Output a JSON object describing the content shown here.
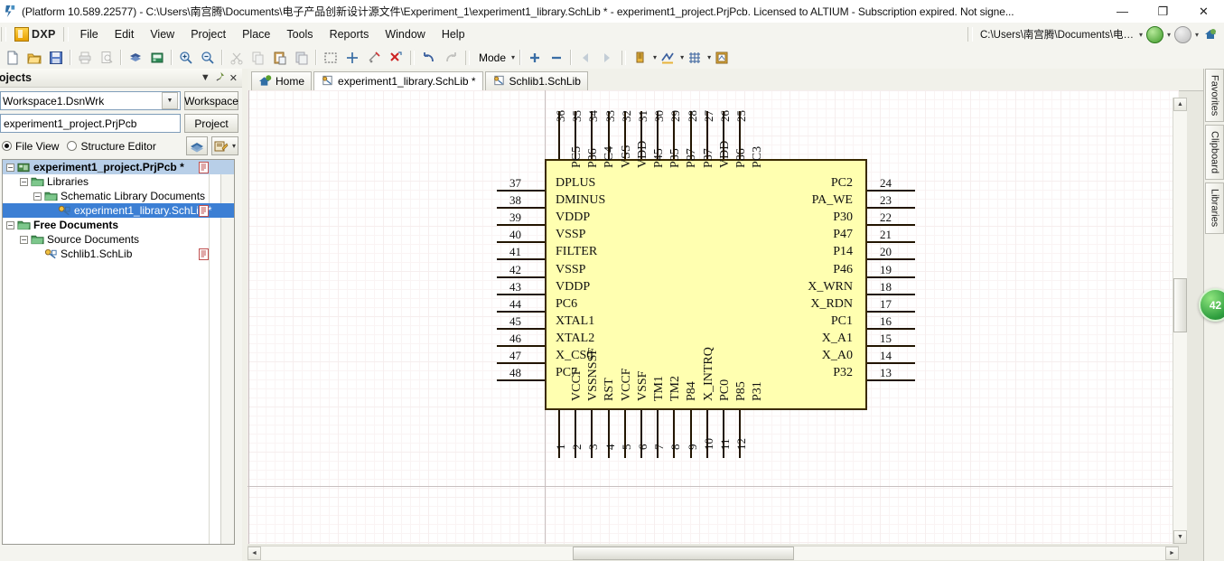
{
  "titlebar": {
    "text": "(Platform 10.589.22577) - C:\\Users\\南宫腾\\Documents\\电子产品创新设计源文件\\Experiment_1\\experiment1_library.SchLib * - experiment1_project.PrjPcb. Licensed to ALTIUM - Subscription expired. Not signe...",
    "minimize": "—",
    "maximize": "❐",
    "close": "✕",
    "app_icon": "altium-icon"
  },
  "menubar": {
    "dxp_label": "DXP",
    "items": [
      {
        "label": "File"
      },
      {
        "label": "Edit"
      },
      {
        "label": "View"
      },
      {
        "label": "Project"
      },
      {
        "label": "Place"
      },
      {
        "label": "Tools"
      },
      {
        "label": "Reports"
      },
      {
        "label": "Window"
      },
      {
        "label": "Help"
      }
    ],
    "address": "C:\\Users\\南宫腾\\Documents\\电…",
    "nav_back_icon": "back-arrow-icon",
    "nav_forward_icon": "forward-arrow-icon",
    "home_icon": "home-icon"
  },
  "toolbar": {
    "buttons": [
      {
        "name": "new-document",
        "icon": "new-doc-icon"
      },
      {
        "name": "open-document",
        "icon": "open-folder-icon"
      },
      {
        "name": "save-document",
        "icon": "save-disk-icon"
      },
      {
        "name": "print",
        "icon": "printer-icon"
      },
      {
        "name": "print-preview",
        "icon": "print-preview-icon"
      },
      {
        "name": "open-project",
        "icon": "project-icon"
      },
      {
        "name": "open-library",
        "icon": "library-icon"
      },
      {
        "name": "zoom-in",
        "icon": "zoom-in-icon"
      },
      {
        "name": "zoom-out",
        "icon": "zoom-out-icon"
      },
      {
        "name": "cut",
        "icon": "scissors-icon"
      },
      {
        "name": "copy",
        "icon": "copy-icon"
      },
      {
        "name": "paste",
        "icon": "paste-icon"
      },
      {
        "name": "paste-special",
        "icon": "paste-special-icon"
      },
      {
        "name": "select-area",
        "icon": "marquee-select-icon"
      },
      {
        "name": "move-selection",
        "icon": "move-cross-icon"
      },
      {
        "name": "clear-selection",
        "icon": "clear-select-icon"
      },
      {
        "name": "deselect-all",
        "icon": "deselect-x-icon"
      },
      {
        "name": "undo",
        "icon": "undo-arrow-icon"
      },
      {
        "name": "redo",
        "icon": "redo-arrow-icon"
      }
    ],
    "mode_label": "Mode",
    "mode_caret": "▾",
    "add_part_icon": "plus-icon",
    "remove_part_icon": "minus-icon",
    "prev_part_icon": "prev-arrow-icon",
    "next_part_icon": "next-arrow-icon",
    "pin_icon": "pin-tool-icon",
    "draw_icon": "draw-tool-icon",
    "grid_icon": "grid-icon",
    "sheet_icon": "sheet-icon"
  },
  "projects_panel": {
    "title": "rojects",
    "header_icons": [
      "chevron-down-icon",
      "pin-icon",
      "close-icon"
    ],
    "workspace_value": "Workspace1.DsnWrk",
    "workspace_button": "Workspace",
    "project_value": "experiment1_project.PrjPcb",
    "project_button": "Project",
    "file_view_label": "File View",
    "structure_editor_label": "Structure Editor",
    "view_mode": "File View",
    "layers_icon": "layers-icon",
    "options_icon": "panel-options-icon",
    "options_caret": "▾",
    "tree": [
      {
        "label": "experiment1_project.PrjPcb *",
        "indent": 0,
        "expander": "−",
        "icon": "project-node-icon",
        "bold": true,
        "selected": "light",
        "doc_badge": true
      },
      {
        "label": "Libraries",
        "indent": 1,
        "expander": "−",
        "icon": "folder-icon",
        "bold": false,
        "selected": "none",
        "doc_badge": false
      },
      {
        "label": "Schematic Library Documents",
        "indent": 2,
        "expander": "−",
        "icon": "folder-icon",
        "bold": false,
        "selected": "none",
        "doc_badge": false
      },
      {
        "label": "experiment1_library.SchLib *",
        "indent": 3,
        "expander": "",
        "icon": "schlib-icon",
        "bold": false,
        "selected": "full",
        "doc_badge": true
      },
      {
        "label": "Free Documents",
        "indent": 0,
        "expander": "−",
        "icon": "folder-icon",
        "bold": true,
        "selected": "none",
        "doc_badge": false
      },
      {
        "label": "Source Documents",
        "indent": 1,
        "expander": "−",
        "icon": "folder-icon",
        "bold": false,
        "selected": "none",
        "doc_badge": false
      },
      {
        "label": "Schlib1.SchLib",
        "indent": 2,
        "expander": "",
        "icon": "schlib-icon",
        "bold": false,
        "selected": "none",
        "doc_badge": true
      }
    ]
  },
  "document_tabs": [
    {
      "label": "Home",
      "icon": "home-tab-icon",
      "active": false
    },
    {
      "label": "experiment1_library.SchLib *",
      "icon": "schlib-tab-icon",
      "active": true
    },
    {
      "label": "Schlib1.SchLib",
      "icon": "schlib-tab-icon",
      "active": false
    }
  ],
  "right_dock": {
    "tabs": [
      "Favorites",
      "Clipboard",
      "Libraries"
    ],
    "badge": "42"
  },
  "scrollbars": {
    "v_up": "▲",
    "v_down": "▼",
    "h_left": "◄",
    "h_right": "►"
  },
  "schematic": {
    "body_color": "#ffffb0",
    "outline_color": "#3a2a00",
    "left_pins": [
      {
        "num": "37",
        "label": "DPLUS"
      },
      {
        "num": "38",
        "label": "DMINUS"
      },
      {
        "num": "39",
        "label": "VDDP"
      },
      {
        "num": "40",
        "label": "VSSP"
      },
      {
        "num": "41",
        "label": "FILTER"
      },
      {
        "num": "42",
        "label": "VSSP"
      },
      {
        "num": "43",
        "label": "VDDP"
      },
      {
        "num": "44",
        "label": "PC6"
      },
      {
        "num": "45",
        "label": "XTAL1"
      },
      {
        "num": "46",
        "label": "XTAL2"
      },
      {
        "num": "47",
        "label": "X_CS0"
      },
      {
        "num": "48",
        "label": "PC7"
      }
    ],
    "right_pins": [
      {
        "num": "24",
        "label": "PC2"
      },
      {
        "num": "23",
        "label": "PA_WE"
      },
      {
        "num": "22",
        "label": "P30"
      },
      {
        "num": "21",
        "label": "P47"
      },
      {
        "num": "20",
        "label": "P14"
      },
      {
        "num": "19",
        "label": "P46"
      },
      {
        "num": "18",
        "label": "X_WRN"
      },
      {
        "num": "17",
        "label": "X_RDN"
      },
      {
        "num": "16",
        "label": "PC1"
      },
      {
        "num": "15",
        "label": "X_A1"
      },
      {
        "num": "14",
        "label": "X_A0"
      },
      {
        "num": "13",
        "label": "P32"
      }
    ],
    "top_pins": [
      {
        "num": "36",
        "label": "PC5"
      },
      {
        "num": "35",
        "label": "P36"
      },
      {
        "num": "34",
        "label": "PC4"
      },
      {
        "num": "33",
        "label": "VSS"
      },
      {
        "num": "32",
        "label": "VDD"
      },
      {
        "num": "31",
        "label": "P45"
      },
      {
        "num": "30",
        "label": "P35"
      },
      {
        "num": "29",
        "label": "P87"
      },
      {
        "num": "28",
        "label": "P37"
      },
      {
        "num": "27",
        "label": "VDD"
      },
      {
        "num": "26",
        "label": "P86"
      },
      {
        "num": "25",
        "label": "PC3"
      }
    ],
    "bottom_pins": [
      {
        "num": "1",
        "label": "VCCF"
      },
      {
        "num": "2",
        "label": "VSSNSSF"
      },
      {
        "num": "3",
        "label": "RST"
      },
      {
        "num": "4",
        "label": "VCCF"
      },
      {
        "num": "5",
        "label": "VSSF"
      },
      {
        "num": "6",
        "label": "TM1"
      },
      {
        "num": "7",
        "label": "TM2"
      },
      {
        "num": "8",
        "label": "P84"
      },
      {
        "num": "9",
        "label": "X_INTRQ"
      },
      {
        "num": "10",
        "label": "PC0"
      },
      {
        "num": "11",
        "label": "P85"
      },
      {
        "num": "12",
        "label": "P31"
      }
    ]
  }
}
